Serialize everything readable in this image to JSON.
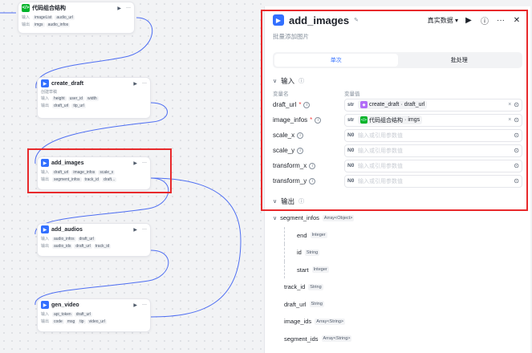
{
  "canvas": {
    "nodes": [
      {
        "title": "代码组合结构",
        "icon": "code",
        "rows": [
          {
            "label": "输入",
            "tags": [
              "imageList",
              "audio_url"
            ]
          },
          {
            "label": "输出",
            "tags": [
              "imgs",
              "audio_infos"
            ]
          }
        ]
      },
      {
        "title": "create_draft",
        "icon": "plugin",
        "subtitle": "创建草稿",
        "rows": [
          {
            "label": "输入",
            "tags": [
              "height",
              "user_id",
              "width"
            ]
          },
          {
            "label": "输出",
            "tags": [
              "draft_url",
              "tip_url"
            ]
          }
        ]
      },
      {
        "title": "add_images",
        "icon": "plugin",
        "rows": [
          {
            "label": "输入",
            "tags": [
              "draft_url",
              "image_infos",
              "scale_x"
            ]
          },
          {
            "label": "输出",
            "tags": [
              "segment_infos",
              "track_id",
              "draft..."
            ]
          }
        ]
      },
      {
        "title": "add_audios",
        "icon": "plugin",
        "rows": [
          {
            "label": "输入",
            "tags": [
              "audio_infos",
              "draft_url"
            ]
          },
          {
            "label": "输出",
            "tags": [
              "audio_ids",
              "draft_url",
              "track_id"
            ]
          }
        ]
      },
      {
        "title": "gen_video",
        "icon": "plugin",
        "rows": [
          {
            "label": "输入",
            "tags": [
              "api_token",
              "draft_url"
            ]
          },
          {
            "label": "输出",
            "tags": [
              "code",
              "msg",
              "tip",
              "video_url"
            ]
          }
        ]
      }
    ]
  },
  "panel": {
    "title": "add_images",
    "description": "批量添加图片",
    "mode_label": "真实数据",
    "tabs": [
      "单次",
      "批处理"
    ],
    "input_section": "输入",
    "col_name": "变量名",
    "col_value": "变量值",
    "params": [
      {
        "name": "draft_url",
        "required": true,
        "type": "str",
        "ref_node": "create_draft",
        "ref_field": "draft_url",
        "ref_icon": "plugin"
      },
      {
        "name": "image_infos",
        "required": true,
        "type": "str",
        "ref_node": "代码组合结构",
        "ref_field": "imgs",
        "ref_icon": "code"
      },
      {
        "name": "scale_x",
        "required": false,
        "type": "N0",
        "placeholder": "输入或引用参数值"
      },
      {
        "name": "scale_y",
        "required": false,
        "type": "N0",
        "placeholder": "输入或引用参数值"
      },
      {
        "name": "transform_x",
        "required": false,
        "type": "N0",
        "placeholder": "输入或引用参数值"
      },
      {
        "name": "transform_y",
        "required": false,
        "type": "N0",
        "placeholder": "输入或引用参数值"
      }
    ],
    "output_section": "输出",
    "outputs": [
      {
        "name": "segment_infos",
        "type": "Array<Object>",
        "level": 0
      },
      {
        "name": "end",
        "type": "Integer",
        "level": 2
      },
      {
        "name": "id",
        "type": "String",
        "level": 2
      },
      {
        "name": "start",
        "type": "Integer",
        "level": 2
      },
      {
        "name": "track_id",
        "type": "String",
        "level": 1
      },
      {
        "name": "draft_url",
        "type": "String",
        "level": 1
      },
      {
        "name": "image_ids",
        "type": "Array<String>",
        "level": 1
      },
      {
        "name": "segment_ids",
        "type": "Array<String>",
        "level": 1
      }
    ]
  }
}
